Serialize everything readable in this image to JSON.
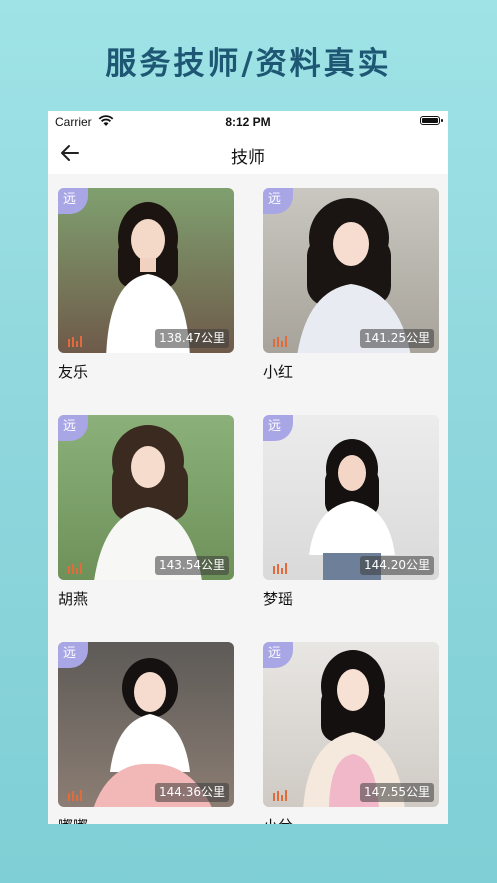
{
  "promo": {
    "title": "服务技师/资料真实"
  },
  "status_bar": {
    "carrier": "Carrier",
    "time": "8:12 PM"
  },
  "nav": {
    "title": "技师"
  },
  "technicians": [
    {
      "name": "友乐",
      "badge": "远",
      "distance": "138.47公里",
      "bg_top": "#7fa06f",
      "bg_bottom": "#6f5a4a",
      "outfit": "#ffffff",
      "hair": "#1b1410"
    },
    {
      "name": "小红",
      "badge": "远",
      "distance": "141.25公里",
      "bg_top": "#c9c7c0",
      "bg_bottom": "#a7a39a",
      "outfit": "#e8ecf2",
      "hair": "#1a1512"
    },
    {
      "name": "胡燕",
      "badge": "远",
      "distance": "143.54公里",
      "bg_top": "#8bb07a",
      "bg_bottom": "#6e9159",
      "outfit": "#f7f7f5",
      "hair": "#3a2a20"
    },
    {
      "name": "梦瑶",
      "badge": "远",
      "distance": "144.20公里",
      "bg_top": "#ececec",
      "bg_bottom": "#d9d9d9",
      "outfit": "#ffffff",
      "hair": "#151111"
    },
    {
      "name": "嘟嘟",
      "badge": "远",
      "distance": "144.36公里",
      "bg_top": "#5d5a57",
      "bg_bottom": "#8b7d73",
      "outfit": "#f2b7b7",
      "hair": "#151111"
    },
    {
      "name": "小兮",
      "badge": "远",
      "distance": "147.55公里",
      "bg_top": "#e8e6e3",
      "bg_bottom": "#cfcac4",
      "outfit": "#f1b8c9",
      "hair": "#141010"
    }
  ]
}
